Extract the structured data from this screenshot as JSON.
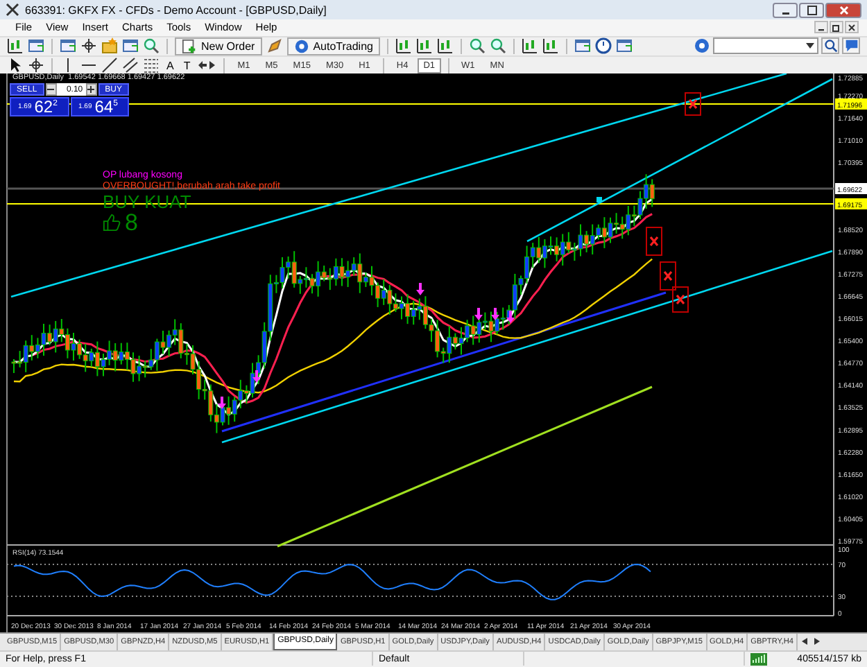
{
  "window": {
    "title": "663391: GKFX FX - CFDs - Demo Account - [GBPUSD,Daily]"
  },
  "menu": [
    "File",
    "View",
    "Insert",
    "Charts",
    "Tools",
    "Window",
    "Help"
  ],
  "toolbar": {
    "buttons": [
      {
        "label": "New Order",
        "kind": "order"
      },
      {
        "label": "AutoTrading",
        "kind": "auto"
      }
    ]
  },
  "text_tools": [
    "A",
    "T"
  ],
  "timeframes": [
    {
      "label": "M1",
      "selected": false
    },
    {
      "label": "M5",
      "selected": false
    },
    {
      "label": "M15",
      "selected": false
    },
    {
      "label": "M30",
      "selected": false
    },
    {
      "label": "H1",
      "selected": false
    },
    {
      "label": "H4",
      "selected": false
    },
    {
      "label": "D1",
      "selected": true
    },
    {
      "label": "W1",
      "selected": false
    },
    {
      "label": "MN",
      "selected": false
    }
  ],
  "chart": {
    "header": "GBPUSD,Daily  1.69542 1.69668 1.69427 1.69622",
    "trade_panel": {
      "sell_label": "SELL",
      "lot": "0.10",
      "buy_label": "BUY",
      "sell_price": {
        "prefix": "1.69",
        "big": "62",
        "small": "2"
      },
      "buy_price": {
        "prefix": "1.69",
        "big": "64",
        "small": "5"
      }
    },
    "signals": [
      {
        "text": "OP lubang kosong",
        "color": "#ff00ff",
        "kind": "note"
      },
      {
        "text": "OVERBOUGHT!,berubah arah take profit",
        "color": "#ff3c14",
        "kind": "note"
      },
      {
        "text": "BUY KUAT",
        "color": "#008c00",
        "kind": "headline"
      }
    ],
    "strength": "8",
    "price_axis": [
      "1.72885",
      "1.72270",
      "1.71640",
      "1.71010",
      "1.70395",
      "1.68520",
      "1.67890",
      "1.67275",
      "1.66645",
      "1.66015",
      "1.65400",
      "1.64770",
      "1.64140",
      "1.63525",
      "1.62895",
      "1.62280",
      "1.61650",
      "1.61020",
      "1.60405",
      "1.59775"
    ],
    "price_highlights": [
      {
        "text": "1.71996",
        "kind": "line"
      },
      {
        "text": "1.69622",
        "kind": "bid"
      },
      {
        "text": "1.69175",
        "kind": "line"
      }
    ],
    "date_axis": [
      "20 Dec 2013",
      "30 Dec 2013",
      "8 Jan 2014",
      "17 Jan 2014",
      "27 Jan 2014",
      "5 Feb 2014",
      "14 Feb 2014",
      "24 Feb 2014",
      "5 Mar 2014",
      "14 Mar 2014",
      "24 Mar 2014",
      "2 Apr 2014",
      "11 Apr 2014",
      "21 Apr 2014",
      "30 Apr 2014"
    ],
    "rsi": {
      "label": "RSI(14) 73.1544",
      "levels": [
        "100",
        "70",
        "30",
        "0"
      ]
    }
  },
  "tabs": [
    {
      "label": "GBPUSD,M15",
      "selected": false
    },
    {
      "label": "GBPUSD,M30",
      "selected": false
    },
    {
      "label": "GBPNZD,H4",
      "selected": false
    },
    {
      "label": "NZDUSD,M5",
      "selected": false
    },
    {
      "label": "EURUSD,H1",
      "selected": false
    },
    {
      "label": "GBPUSD,Daily",
      "selected": true
    },
    {
      "label": "GBPUSD,H1",
      "selected": false
    },
    {
      "label": "GOLD,Daily",
      "selected": false
    },
    {
      "label": "USDJPY,Daily",
      "selected": false
    },
    {
      "label": "AUDUSD,H4",
      "selected": false
    },
    {
      "label": "USDCAD,Daily",
      "selected": false
    },
    {
      "label": "GOLD,Daily",
      "selected": false
    },
    {
      "label": "GBPJPY,M15",
      "selected": false
    },
    {
      "label": "GOLD,H4",
      "selected": false
    },
    {
      "label": "GBPTRY,H4",
      "selected": false
    }
  ],
  "status_bar": [
    "For Help, press F1",
    "Default",
    "405514/157 kb"
  ]
}
